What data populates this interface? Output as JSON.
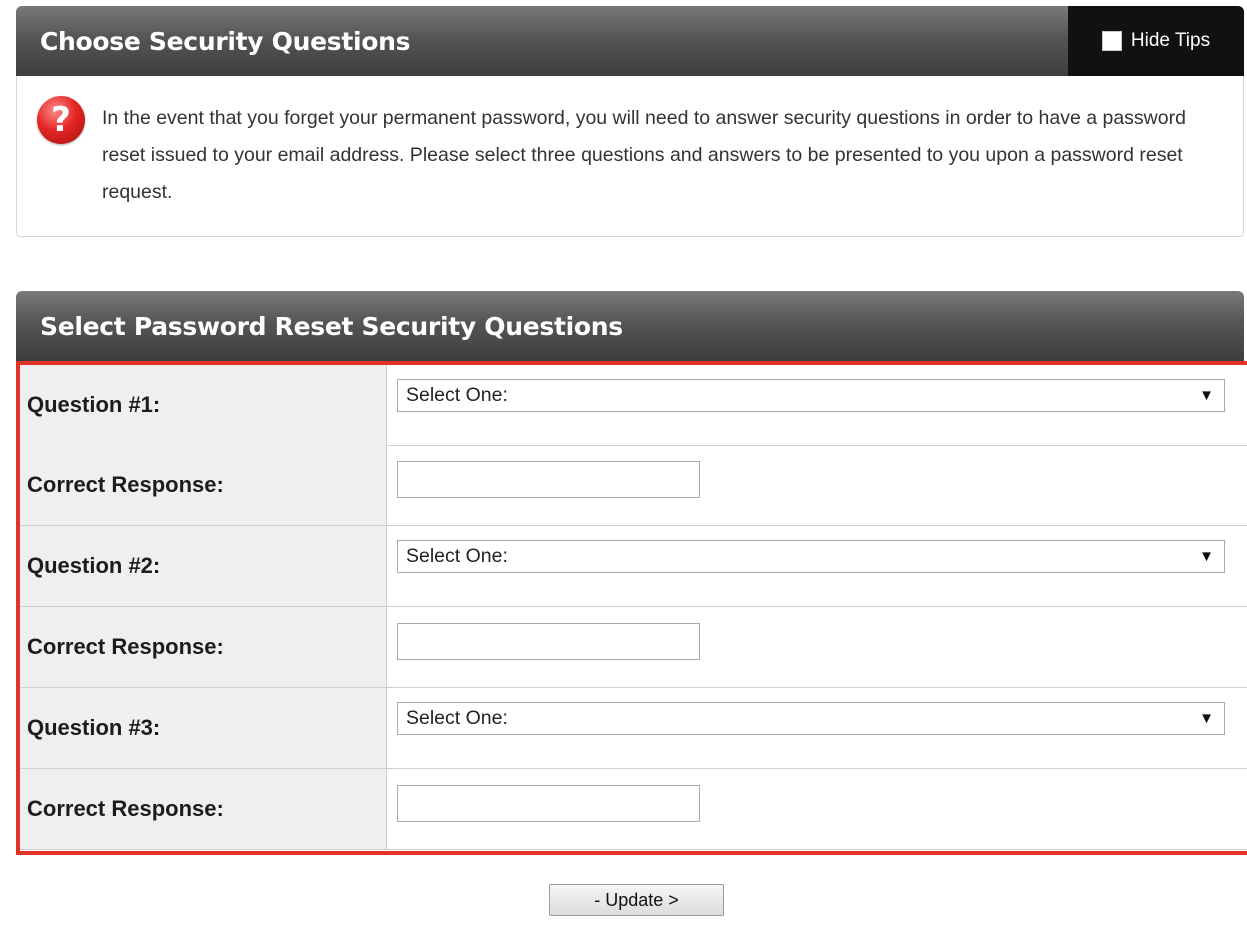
{
  "tips_panel": {
    "title": "Choose Security Questions",
    "hide_tips_label": "Hide Tips",
    "text": "In the event that you forget your permanent password, you will need to answer security questions in order to have a password reset issued to your email address. Please select three questions and answers to be presented to you upon a password reset request."
  },
  "questions_panel": {
    "title": "Select Password Reset Security Questions",
    "rows": [
      {
        "label": "Question #1:",
        "kind": "select",
        "value": "Select One:"
      },
      {
        "label": "Correct Response:",
        "kind": "input",
        "value": ""
      },
      {
        "label": "Question #2:",
        "kind": "select",
        "value": "Select One:"
      },
      {
        "label": "Correct Response:",
        "kind": "input",
        "value": ""
      },
      {
        "label": "Question #3:",
        "kind": "select",
        "value": "Select One:"
      },
      {
        "label": "Correct Response:",
        "kind": "input",
        "value": ""
      }
    ]
  },
  "update_button_label": "- Update >",
  "colors": {
    "highlight_border": "#e03328",
    "header_dark": "#3e3e3e",
    "icon_red": "#e52626"
  }
}
